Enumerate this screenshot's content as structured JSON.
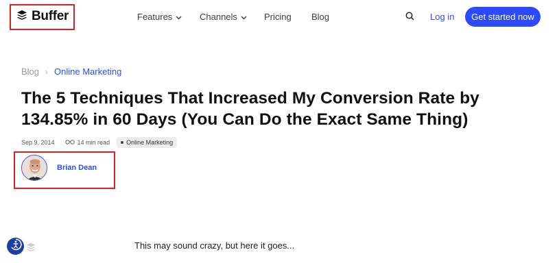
{
  "brand": {
    "name": "Buffer"
  },
  "nav": {
    "features": "Features",
    "channels": "Channels",
    "pricing": "Pricing",
    "blog": "Blog"
  },
  "header": {
    "login": "Log in",
    "cta": "Get started now"
  },
  "breadcrumb": {
    "root": "Blog",
    "separator": "›",
    "current": "Online Marketing"
  },
  "article": {
    "title": "The 5 Techniques That Increased My Conversion Rate by 134.85% in 60 Days (You Can Do the Exact Same Thing)",
    "date": "Sep 9, 2014",
    "read_time": "14 min read",
    "category": "Online Marketing",
    "author": "Brian Dean",
    "lead": "This may sound crazy, but here it goes..."
  },
  "colors": {
    "accent": "#2c4bff",
    "highlight_box": "#e02020"
  }
}
